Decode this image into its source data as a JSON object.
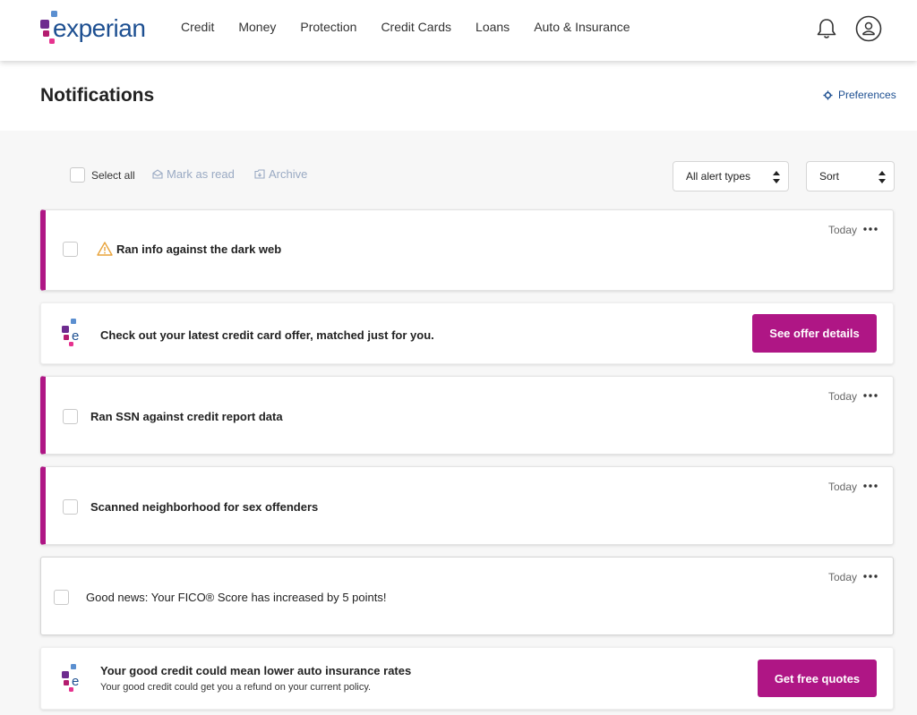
{
  "header": {
    "logo_text": "experian",
    "nav": [
      "Credit",
      "Money",
      "Protection",
      "Credit Cards",
      "Loans",
      "Auto & Insurance"
    ],
    "bell_icon": "bell-icon",
    "avatar_icon": "user-icon"
  },
  "page": {
    "title": "Notifications",
    "preferences_label": "Preferences"
  },
  "toolbar": {
    "select_all": "Select all",
    "mark_as_read": "Mark as read",
    "archive": "Archive",
    "alert_types": "All alert types",
    "sort": "Sort"
  },
  "notifications": [
    {
      "type": "alert",
      "when": "Today",
      "text": "Ran info against the dark web",
      "icon": "warning-icon"
    },
    {
      "type": "offer",
      "text": "Check out your latest credit card offer, matched just for you.",
      "cta": "See offer details"
    },
    {
      "type": "alert",
      "when": "Today",
      "text": "Ran SSN against credit report data"
    },
    {
      "type": "alert",
      "when": "Today",
      "text": "Scanned neighborhood for sex offenders"
    },
    {
      "type": "info",
      "when": "Today",
      "text": "Good news: Your FICO® Score has increased by 5 points!"
    },
    {
      "type": "offer",
      "text": "Your good credit could mean lower auto insurance rates",
      "subtext": "Your good credit could get you a refund on your current policy.",
      "cta": "Get free quotes"
    }
  ],
  "colors": {
    "brand_magenta": "#af1685",
    "brand_blue": "#1d4f91",
    "warning": "#e8a33a"
  }
}
